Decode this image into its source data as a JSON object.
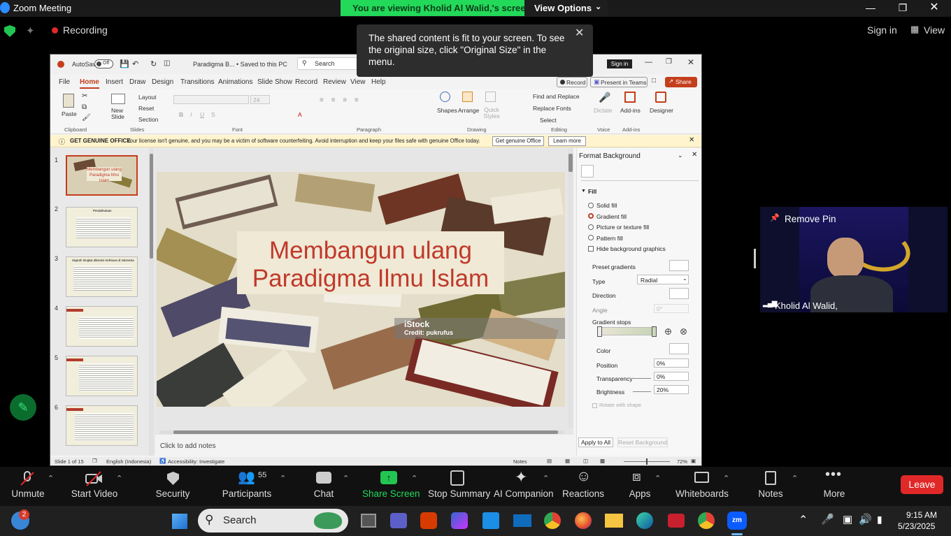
{
  "zoom": {
    "title": "Zoom Meeting",
    "viewing_banner": "You are viewing Kholid Al Walid,'s screen",
    "view_options": "View Options",
    "recording": "Recording",
    "sign_in": "Sign in",
    "view": "View",
    "tooltip": "The shared content is fit to your screen. To see the original size, click \"Original Size\" in the menu."
  },
  "ppt": {
    "autosave": "AutoSave",
    "autosave_state": "Off",
    "doc_title": "Paradigma B... • Saved to this PC",
    "search": "Search",
    "sign_in": "Sign in",
    "tabs": [
      "File",
      "Home",
      "Insert",
      "Draw",
      "Design",
      "Transitions",
      "Animations",
      "Slide Show",
      "Record",
      "Review",
      "View",
      "Help"
    ],
    "record_btn": "Record",
    "present_teams": "Present in Teams",
    "share": "Share",
    "ribbon": {
      "paste": "Paste",
      "new_slide": "New Slide",
      "layout": "Layout",
      "reset": "Reset",
      "section": "Section",
      "font_size": "24",
      "shapes": "Shapes",
      "arrange": "Arrange",
      "quick_styles": "Quick Styles",
      "find_replace": "Find and Replace",
      "replace_fonts": "Replace Fonts",
      "select": "Select",
      "dictate": "Dictate",
      "addins": "Add-ins",
      "designer": "Designer",
      "groups": [
        "Clipboard",
        "Slides",
        "Font",
        "Paragraph",
        "Drawing",
        "Editing",
        "Voice",
        "Add-ins"
      ]
    },
    "license": {
      "label": "GET GENUINE OFFICE",
      "message": "Your license isn't genuine, and you may be a victim of software counterfeiting. Avoid interruption and keep your files safe with genuine Office today.",
      "get_btn": "Get genuine Office",
      "learn_btn": "Learn more"
    },
    "thumbs": [
      {
        "num": "1",
        "title": "Membangun ulang Paradigma Ilmu Islam"
      },
      {
        "num": "2",
        "title": "Pendahuluan"
      },
      {
        "num": "3",
        "title": "Sejarah Singkat dikotomi Keilmuan di Indonesia"
      },
      {
        "num": "4",
        "title": ""
      },
      {
        "num": "5",
        "title": ""
      },
      {
        "num": "6",
        "title": ""
      }
    ],
    "slide": {
      "title_line1": "Membangun ulang",
      "title_line2": "Paradigma Ilmu Islam",
      "watermark": "iStock",
      "credit": "Credit: pukrufus"
    },
    "notes": "Click to add notes",
    "format": {
      "title": "Format Background",
      "fill": "Fill",
      "options": [
        "Solid fill",
        "Gradient fill",
        "Picture or texture fill",
        "Pattern fill"
      ],
      "selected": "Gradient fill",
      "hide_bg": "Hide background graphics",
      "preset": "Preset gradients",
      "type_label": "Type",
      "type_value": "Radial",
      "direction": "Direction",
      "angle": "Angle",
      "angle_value": "0°",
      "stops": "Gradient stops",
      "color": "Color",
      "position": "Position",
      "position_value": "0%",
      "transparency": "Transparency",
      "transparency_value": "0%",
      "brightness": "Brightness",
      "brightness_value": "20%",
      "rotate": "Rotate with shape",
      "apply_all": "Apply to All",
      "reset_bg": "Reset Background"
    },
    "status": {
      "slide": "Slide 1 of 15",
      "lang": "English (Indonesia)",
      "access": "Accessibility: Investigate",
      "notes": "Notes",
      "zoom": "72%"
    }
  },
  "video": {
    "remove_pin": "Remove Pin",
    "name": "Kholid Al Walid,"
  },
  "toolbar": {
    "items": [
      "Unmute",
      "Start Video",
      "Security",
      "Participants",
      "Chat",
      "Share Screen",
      "Stop Summary",
      "AI Companion",
      "Reactions",
      "Apps",
      "Whiteboards",
      "Notes",
      "More"
    ],
    "participants_count": "55",
    "leave": "Leave"
  },
  "taskbar": {
    "search": "Search",
    "time": "9:15 AM",
    "date": "5/23/2025",
    "badge": "2"
  }
}
